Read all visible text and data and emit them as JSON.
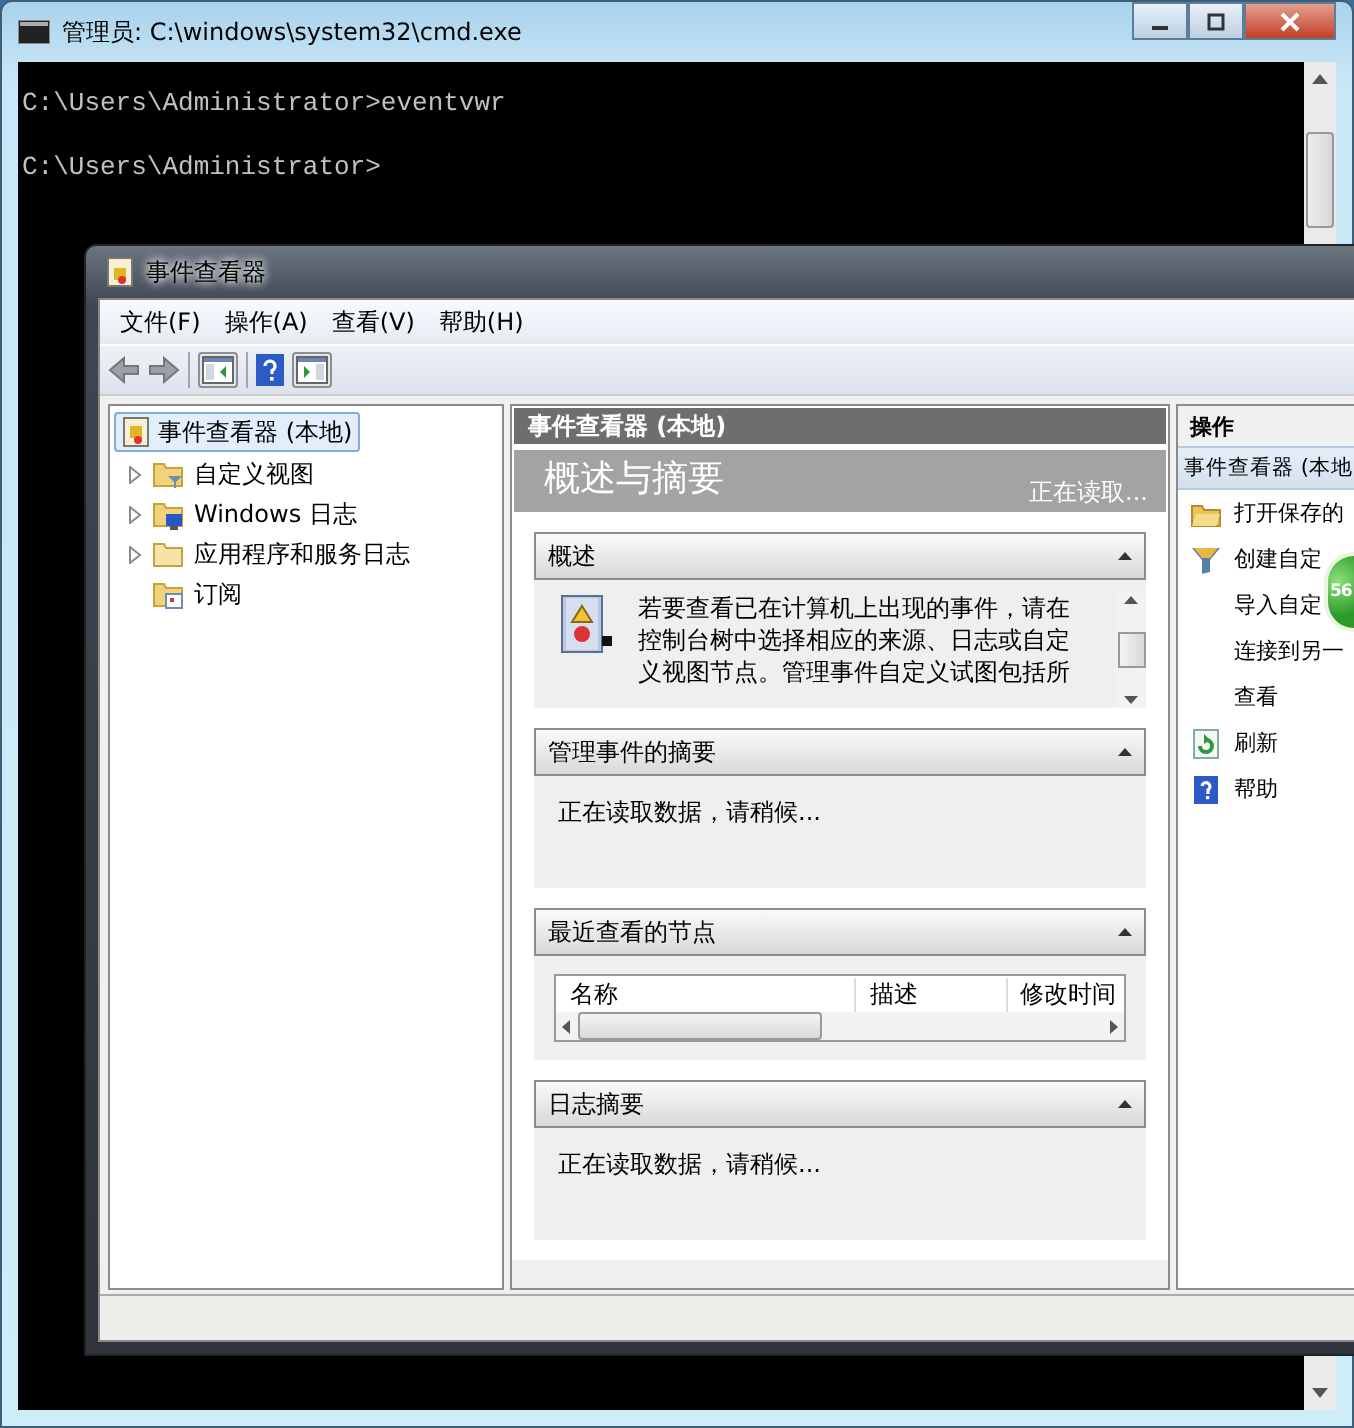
{
  "console": {
    "title": "管理员: C:\\windows\\system32\\cmd.exe",
    "lines": [
      "C:\\Users\\Administrator>eventvwr",
      "C:\\Users\\Administrator>"
    ]
  },
  "event_viewer": {
    "title": "事件查看器",
    "menu": [
      {
        "label": "文件(F)"
      },
      {
        "label": "操作(A)"
      },
      {
        "label": "查看(V)"
      },
      {
        "label": "帮助(H)"
      }
    ],
    "tree": {
      "label": "事件查看器 (本地)",
      "selected": true,
      "children": [
        {
          "label": "自定义视图",
          "expandable": true,
          "selected": false
        },
        {
          "label": "Windows 日志",
          "expandable": true,
          "selected": false
        },
        {
          "label": "应用程序和服务日志",
          "expandable": true,
          "selected": false
        },
        {
          "label": "订阅",
          "expandable": false,
          "selected": false
        }
      ]
    },
    "center": {
      "header": "事件查看器 (本地)",
      "title": "概述与摘要",
      "status": "正在读取...",
      "sections": [
        {
          "kind": "overview",
          "title": "概述",
          "lines": [
            "若要查看已在计算机上出现的事件，请在",
            "控制台树中选择相应的来源、日志或自定",
            "义视图节点。管理事件自定义试图包括所"
          ]
        },
        {
          "kind": "message",
          "title": "管理事件的摘要",
          "text": "正在读取数据，请稍候..."
        },
        {
          "kind": "table",
          "title": "最近查看的节点",
          "columns": [
            "名称",
            "描述",
            "修改时间"
          ]
        },
        {
          "kind": "message",
          "title": "日志摘要",
          "text": "正在读取数据，请稍候..."
        }
      ]
    },
    "actions": {
      "header": "操作",
      "group": "事件查看器 (本地",
      "items": [
        {
          "label": "打开保存的"
        },
        {
          "label": "创建自定"
        },
        {
          "label": "导入自定"
        },
        {
          "label": "连接到另一"
        },
        {
          "label": "查看"
        },
        {
          "label": "刷新"
        },
        {
          "label": "帮助"
        }
      ]
    }
  },
  "floating_badge": {
    "text": "56"
  }
}
